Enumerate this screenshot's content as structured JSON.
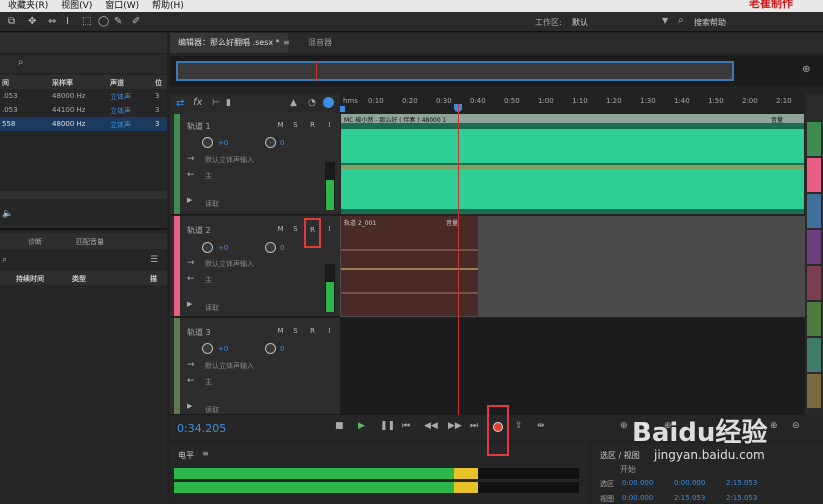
{
  "menu": [
    "收藏夹(R)",
    "视图(V)",
    "窗口(W)",
    "帮助(H)"
  ],
  "watermark": "老崔制作",
  "workspace": {
    "label": "工作区:",
    "value": "默认",
    "search": "搜索帮助"
  },
  "files": {
    "headers": [
      "间",
      "采样率",
      "声道",
      "位"
    ],
    "rows": [
      {
        "d": ".053",
        "r": "48000 Hz",
        "c": "立体声",
        "b": "3"
      },
      {
        "d": ".053",
        "r": "44100 Hz",
        "c": "立体声",
        "b": "3"
      },
      {
        "d": "558",
        "r": "48000 Hz",
        "c": "立体声",
        "b": "3"
      }
    ]
  },
  "panels": {
    "diagnose": "诊断",
    "match": "匹配音量",
    "dur": "持续时间",
    "type": "类型",
    "col3": "描"
  },
  "editor": {
    "tab1": "编辑器：那么好翻唱 .sesx *",
    "tab2": "混音器"
  },
  "ruler": [
    "hms",
    "0:10",
    "0:20",
    "0:30",
    "0:40",
    "0:50",
    "1:00",
    "1:10",
    "1:20",
    "1:30",
    "1:40",
    "1:50",
    "2:00",
    "2:10"
  ],
  "tracks": [
    {
      "name": "轨道 1",
      "vol": "+0",
      "pan": "0",
      "input": "默认立体声输入",
      "out": "主",
      "read": "读取",
      "clip": "MC 椒小然 - 那么好 ( 伴奏 ) 48000 1",
      "clipfx": "音量"
    },
    {
      "name": "轨道 2",
      "vol": "+0",
      "pan": "0",
      "input": "默认立体声输入",
      "out": "主",
      "read": "读取",
      "clip": "轨道 2_001",
      "clipfx": "音量"
    },
    {
      "name": "轨道 3",
      "vol": "+0",
      "pan": "0",
      "input": "默认立体声输入",
      "out": "主",
      "read": "读取"
    }
  ],
  "msri": [
    "M",
    "S",
    "R",
    "I"
  ],
  "time": "0:34.205",
  "level": "电平",
  "selection": {
    "title": "选区 / 视图",
    "start": "开始",
    "sel_lbl": "选区",
    "view_lbl": "视图",
    "s1": "0:00.000",
    "s2": "0:00.000",
    "s3": "2:15.053",
    "v1": "0:00.000",
    "v2": "2:15.053",
    "v3": "2:15.053"
  },
  "brand": "Baidu经验",
  "site": "jingyan.baidu.com"
}
